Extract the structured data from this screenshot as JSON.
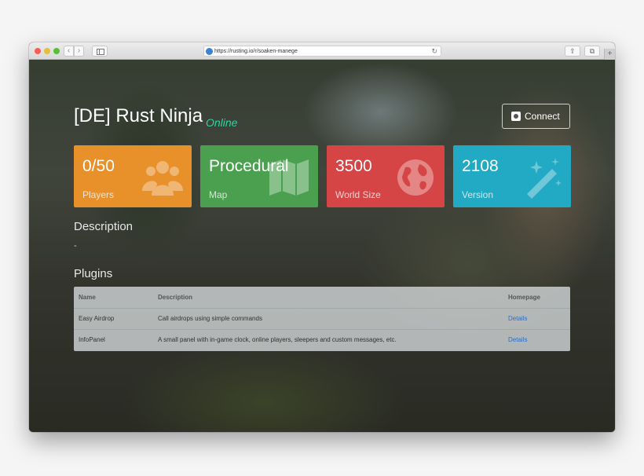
{
  "browser": {
    "url": "https://rusting.io/r/soaken-manege",
    "nav_back": "‹",
    "nav_forward": "›",
    "reload_icon": "↻",
    "share_icon": "⇪",
    "tabs_icon": "⧉",
    "newtab_icon": "+"
  },
  "server": {
    "title": "[DE] Rust Ninja",
    "status": "Online",
    "connect_label": "Connect"
  },
  "stats": [
    {
      "value": "0/50",
      "label": "Players",
      "icon": "users-icon",
      "color": "#e8902a"
    },
    {
      "value": "Procedural",
      "label": "Map",
      "icon": "map-icon",
      "color": "#4aa04e"
    },
    {
      "value": "3500",
      "label": "World Size",
      "icon": "globe-icon",
      "color": "#d64545"
    },
    {
      "value": "2108",
      "label": "Version",
      "icon": "magic-wand-icon",
      "color": "#22a9c4"
    }
  ],
  "description": {
    "title": "Description",
    "text": "-"
  },
  "plugins": {
    "title": "Plugins",
    "headers": [
      "Name",
      "Description",
      "Homepage"
    ],
    "rows": [
      [
        "Easy Airdrop",
        "Call airdrops using simple commands",
        "Details"
      ],
      [
        "InfoPanel",
        "A small panel with in-game clock, online players, sleepers and custom messages, etc.",
        "Details"
      ]
    ]
  }
}
